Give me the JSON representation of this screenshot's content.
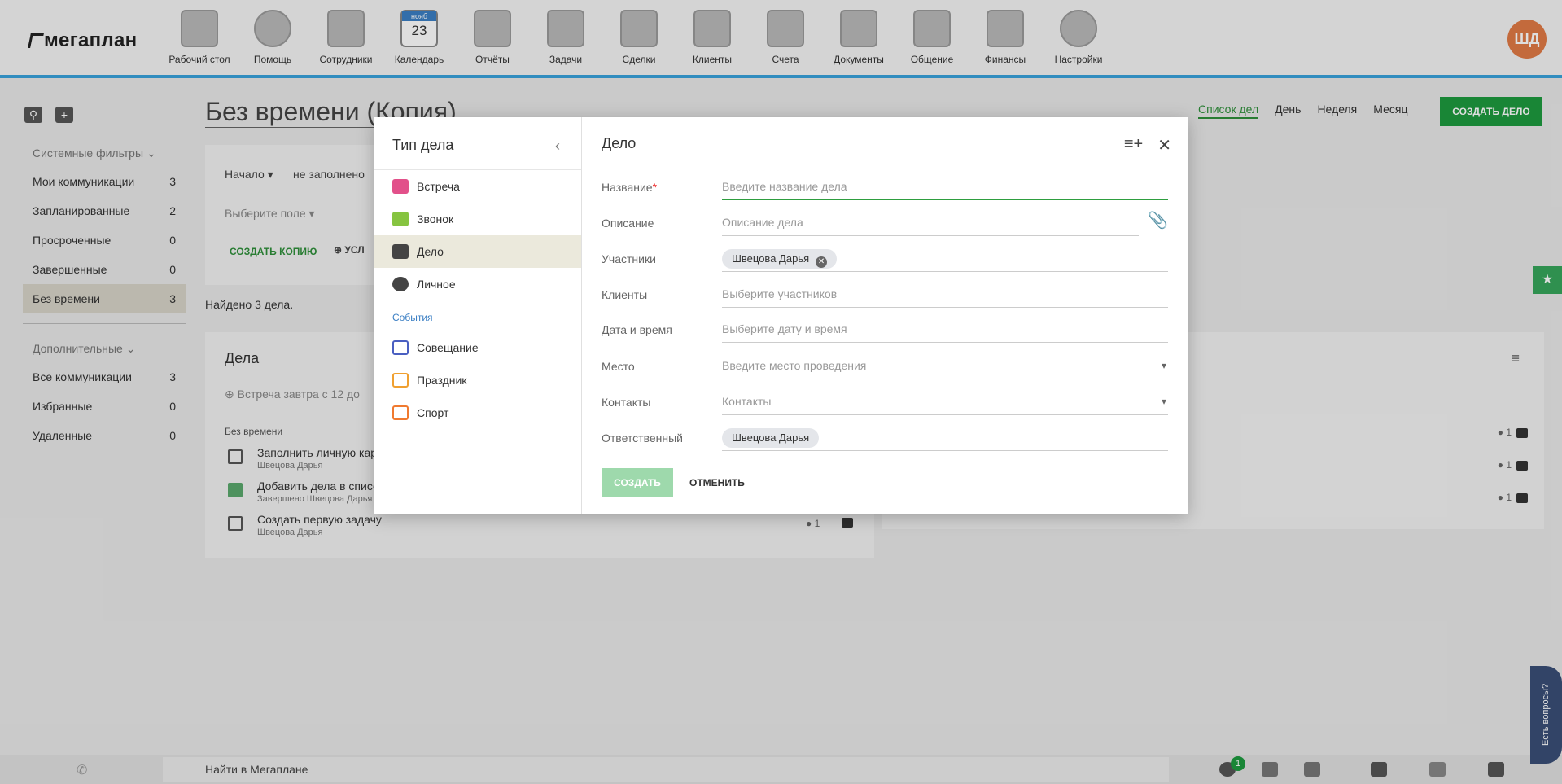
{
  "app": {
    "logo": "мегаплан",
    "avatar": "ШД"
  },
  "nav": [
    {
      "label": "Рабочий стол",
      "icon": "desktop-icon"
    },
    {
      "label": "Помощь",
      "icon": "lifebuoy-icon"
    },
    {
      "label": "Сотрудники",
      "icon": "contacts-icon"
    },
    {
      "label": "Календарь",
      "icon": "calendar-icon",
      "month": "нояб",
      "day": "23"
    },
    {
      "label": "Отчёты",
      "icon": "chart-icon"
    },
    {
      "label": "Задачи",
      "icon": "clipboard-icon"
    },
    {
      "label": "Сделки",
      "icon": "briefcase-icon"
    },
    {
      "label": "Клиенты",
      "icon": "address-book-icon"
    },
    {
      "label": "Счета",
      "icon": "invoice-icon"
    },
    {
      "label": "Документы",
      "icon": "folder-icon"
    },
    {
      "label": "Общение",
      "icon": "chat-icon"
    },
    {
      "label": "Финансы",
      "icon": "safe-icon"
    },
    {
      "label": "Настройки",
      "icon": "gear-icon"
    }
  ],
  "sidebar": {
    "system_label": "Системные фильтры",
    "system": [
      {
        "label": "Мои коммуникации",
        "count": "3"
      },
      {
        "label": "Запланированные",
        "count": "2"
      },
      {
        "label": "Просроченные",
        "count": "0"
      },
      {
        "label": "Завершенные",
        "count": "0"
      },
      {
        "label": "Без времени",
        "count": "3"
      }
    ],
    "extra_label": "Дополнительные",
    "extra": [
      {
        "label": "Все коммуникации",
        "count": "3"
      },
      {
        "label": "Избранные",
        "count": "0"
      },
      {
        "label": "Удаленные",
        "count": "0"
      }
    ]
  },
  "page": {
    "title": "Без времени (Копия)"
  },
  "viewtabs": [
    "Список дел",
    "День",
    "Неделя",
    "Месяц"
  ],
  "create_button": "СОЗДАТЬ ДЕЛО",
  "filters": {
    "start": "Начало",
    "empty": "не заполнено",
    "choose_field": "Выберите поле",
    "copy": "СОЗДАТЬ КОПИЮ",
    "cond": "УСЛ"
  },
  "found": "Найдено 3 дела.",
  "deals": {
    "title": "Дела",
    "quick_placeholder": "Встреча завтра с 12 до",
    "section": "Без времени",
    "items": [
      {
        "title": "Заполнить личную карт",
        "sub": "Швецова Дарья",
        "done": false
      },
      {
        "title": "Добавить дела в список",
        "sub": "Завершено Швецова Дарья",
        "done": true
      },
      {
        "title": "Создать первую задачу",
        "sub": "Швецова Дарья",
        "done": false
      }
    ],
    "count": "1"
  },
  "modal": {
    "left_title": "Тип дела",
    "types": [
      {
        "label": "Встреча",
        "color": "#e2508a"
      },
      {
        "label": "Звонок",
        "color": "#86c440"
      },
      {
        "label": "Дело",
        "color": "#444444"
      },
      {
        "label": "Личное",
        "color": "#444444"
      }
    ],
    "events_label": "События",
    "events": [
      {
        "label": "Совещание",
        "color": "#4a5fc1"
      },
      {
        "label": "Праздник",
        "color": "#f0a030"
      },
      {
        "label": "Спорт",
        "color": "#f07a30"
      }
    ],
    "right_title": "Дело",
    "fields": [
      {
        "label": "Название",
        "placeholder": "Введите название дела"
      },
      {
        "label": "Описание",
        "placeholder": "Описание дела"
      },
      {
        "label": "Участники",
        "chip": "Швецова Дарья"
      },
      {
        "label": "Клиенты",
        "placeholder": "Выберите участников"
      },
      {
        "label": "Дата и время",
        "placeholder": "Выберите дату и время"
      },
      {
        "label": "Место",
        "placeholder": "Введите место проведения"
      },
      {
        "label": "Контакты",
        "placeholder": "Контакты"
      },
      {
        "label": "Ответственный",
        "chip": "Швецова Дарья"
      }
    ],
    "create": "СОЗДАТЬ",
    "cancel": "ОТМЕНИТЬ"
  },
  "bottom": {
    "search": "Найти в Мегаплане",
    "badge": "1",
    "help": "Есть вопросы?"
  },
  "colors": {
    "accent_green": "#1d9a3f",
    "topbar_line": "#39a3dc"
  }
}
